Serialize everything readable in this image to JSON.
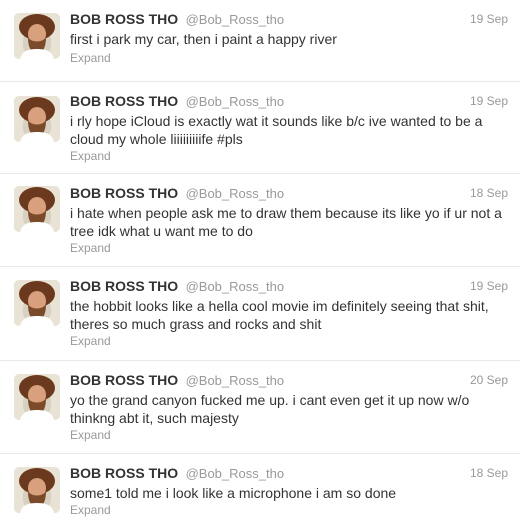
{
  "colors": {
    "text": "#333333",
    "meta": "#999999",
    "divider": "#e8e8e8"
  },
  "tweets": [
    {
      "name": "BOB ROSS THO",
      "handle": "@Bob_Ross_tho",
      "time": "19 Sep",
      "text": "first i park my car, then i paint a happy river",
      "expand": "Expand"
    },
    {
      "name": "BOB ROSS THO",
      "handle": "@Bob_Ross_tho",
      "time": "19 Sep",
      "text": "i rly hope iCloud is exactly wat it sounds like b/c ive wanted to be a cloud my whole liiiiiiiiife #pls",
      "expand": "Expand"
    },
    {
      "name": "BOB ROSS THO",
      "handle": "@Bob_Ross_tho",
      "time": "18 Sep",
      "text": "i hate when people ask me to draw them because its like yo if ur not a tree idk what u want me to do",
      "expand": "Expand"
    },
    {
      "name": "BOB ROSS THO",
      "handle": "@Bob_Ross_tho",
      "time": "19 Sep",
      "text": "the hobbit looks like a hella cool movie im definitely seeing that shit, theres so much grass and rocks and shit",
      "expand": "Expand"
    },
    {
      "name": "BOB ROSS THO",
      "handle": "@Bob_Ross_tho",
      "time": "20 Sep",
      "text": "yo the grand canyon fucked me up. i cant even get it up now w/o thinkng abt it, such majesty",
      "expand": "Expand"
    },
    {
      "name": "BOB ROSS THO",
      "handle": "@Bob_Ross_tho",
      "time": "18 Sep",
      "text": "some1 told me i look like a microphone i am so done",
      "expand": "Expand"
    }
  ]
}
